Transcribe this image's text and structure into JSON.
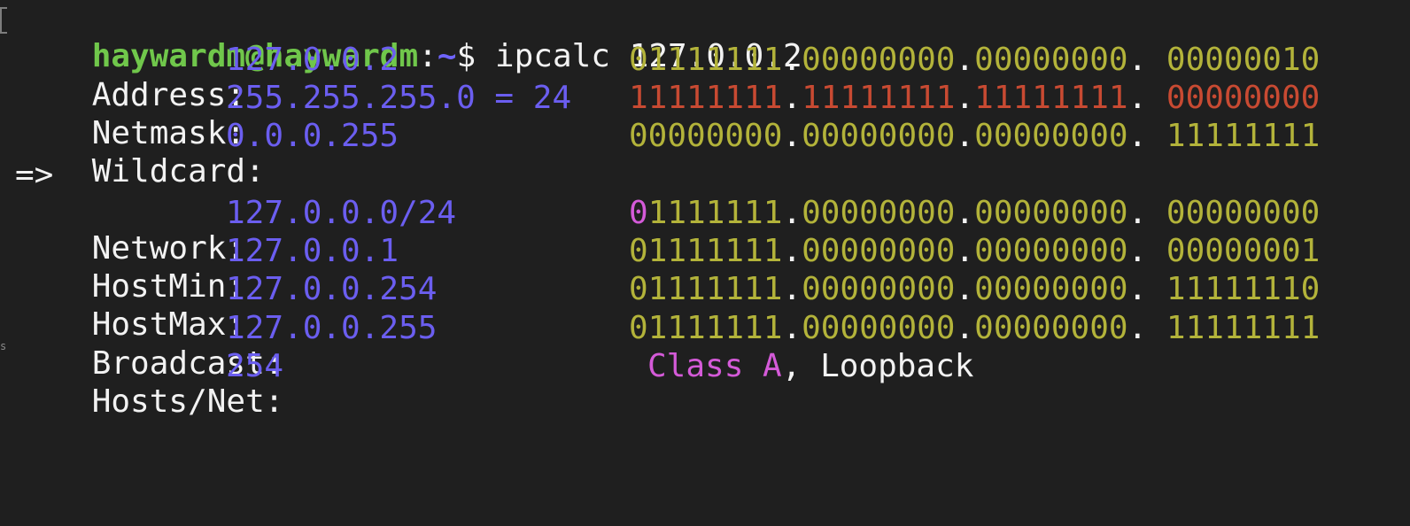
{
  "prompt": {
    "user_host": "haywardm@haywardm",
    "separator": ":",
    "path": "~",
    "symbol": "$",
    "command": "ipcalc 127.0.0.2"
  },
  "rows": {
    "address": {
      "label": "Address:",
      "value": "127.0.0.2",
      "octet1": "01111111",
      "octet2": "00000000",
      "octet3": "00000000",
      "octet4": "00000010"
    },
    "netmask": {
      "label": "Netmask:",
      "value": "255.255.255.0 = 24",
      "octet1": "11111111",
      "octet2": "11111111",
      "octet3": "11111111",
      "octet4": "00000000"
    },
    "wildcard": {
      "label": "Wildcard:",
      "value": "0.0.0.255",
      "octet1": "00000000",
      "octet2": "00000000",
      "octet3": "00000000",
      "octet4": "11111111"
    },
    "arrow": "=>",
    "network": {
      "label": "Network:",
      "value": "127.0.0.0/24",
      "class_bit": "0",
      "octet1_rest": "1111111",
      "octet2": "00000000",
      "octet3": "00000000",
      "octet4": "00000000"
    },
    "hostmin": {
      "label": "HostMin:",
      "value": "127.0.0.1",
      "octet1": "01111111",
      "octet2": "00000000",
      "octet3": "00000000",
      "octet4": "00000001"
    },
    "hostmax": {
      "label": "HostMax:",
      "value": "127.0.0.254",
      "octet1": "01111111",
      "octet2": "00000000",
      "octet3": "00000000",
      "octet4": "11111110"
    },
    "broadcast": {
      "label": "Broadcast:",
      "value": "127.0.0.255",
      "octet1": "01111111",
      "octet2": "00000000",
      "octet3": "00000000",
      "octet4": "11111111"
    },
    "hosts": {
      "label": "Hosts/Net:",
      "value": "254",
      "class_text": "Class A",
      "suffix": ", Loopback"
    }
  },
  "dot": ".",
  "dot_space": ". ",
  "gutter_letter": "s",
  "colors": {
    "background": "#1f1f1f",
    "user_host": "#70c74b",
    "path": "#6f64ff",
    "value": "#6b5ef0",
    "binary": "#b3b33a",
    "netmask_binary": "#c84a32",
    "class": "#d45ad8",
    "text": "#f2f2f2"
  }
}
